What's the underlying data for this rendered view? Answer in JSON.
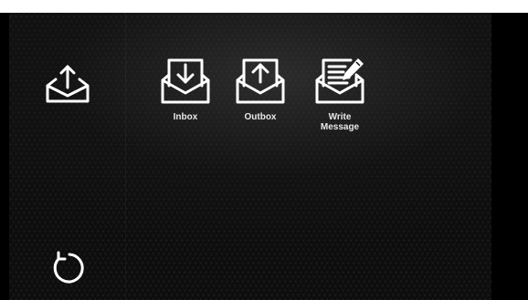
{
  "sidebar": {
    "mail_icon": "mail-export-icon",
    "back_icon": "refresh-back-icon"
  },
  "menu": {
    "items": [
      {
        "label": "Inbox",
        "icon": "inbox-envelope-icon"
      },
      {
        "label": "Outbox",
        "icon": "outbox-envelope-icon"
      },
      {
        "label": "Write\nMessage",
        "icon": "write-message-icon"
      }
    ]
  },
  "colors": {
    "background": "#0b0b0b",
    "icon_stroke": "#ffffff",
    "label_text": "#e8e8e8"
  }
}
